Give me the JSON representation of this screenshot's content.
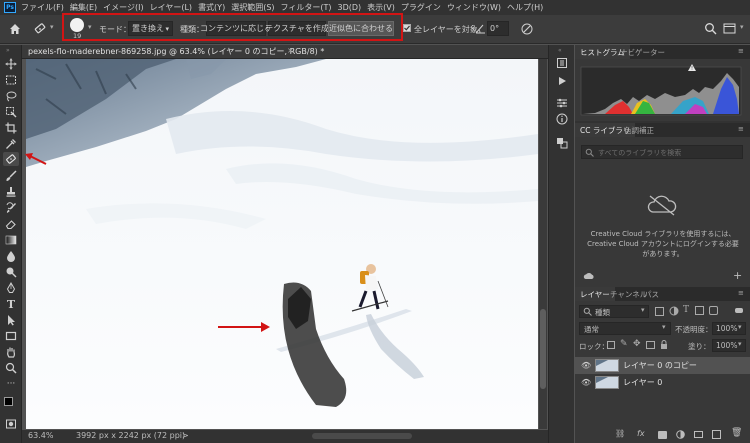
{
  "app": {
    "logo_text": "Ps"
  },
  "menu": [
    "ファイル(F)",
    "編集(E)",
    "イメージ(I)",
    "レイヤー(L)",
    "書式(Y)",
    "選択範囲(S)",
    "フィルター(T)",
    "3D(D)",
    "表示(V)",
    "プラグイン",
    "ウィンドウ(W)",
    "ヘルプ(H)"
  ],
  "options": {
    "brush_size": "19",
    "mode_label": "モード：",
    "mode_value": "置き換え",
    "type_label": "種類：",
    "type_buttons": [
      "コンテンツに応じる",
      "テクスチャを作成",
      "近似色に合わせる"
    ],
    "type_active_index": 2,
    "sample_all_layers": "全レイヤーを対象",
    "angle_value": "0°",
    "accent_color": "#d21414"
  },
  "document": {
    "tab_title": "pexels-flo-maderebner-869258.jpg @ 63.4% (レイヤー 0 のコピー, RGB/8) *",
    "close_glyph": "×"
  },
  "status": {
    "zoom": "63.4%",
    "dimensions": "3992 px x 2242 px (72 ppi)",
    "arrow": ">"
  },
  "panels": {
    "histogram": {
      "tabs": [
        "ヒストグラム",
        "ナビゲーター"
      ]
    },
    "library": {
      "tabs": [
        "CC ライブラリ",
        "色調補正"
      ],
      "search_placeholder": "すべてのライブラリを検索",
      "message": "Creative Cloud ライブラリを使用するには、Creative Cloud アカウントにログインする必要があります。"
    },
    "layers": {
      "tabs": [
        "レイヤー",
        "チャンネル",
        "パス"
      ],
      "filter_kind": "種類",
      "blend_mode": "通常",
      "opacity_label": "不透明度：",
      "opacity_value": "100%",
      "lock_label": "ロック：",
      "fill_label": "塗り：",
      "fill_value": "100%",
      "items": [
        {
          "name": "レイヤー 0 のコピー",
          "visible": true,
          "selected": true
        },
        {
          "name": "レイヤー 0",
          "visible": true,
          "selected": false
        }
      ]
    }
  }
}
